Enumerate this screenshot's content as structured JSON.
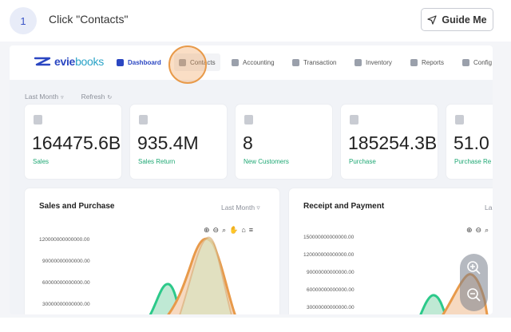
{
  "step": {
    "number": "1",
    "instruction": "Click \"Contacts\""
  },
  "guide_button": {
    "label": "Guide Me"
  },
  "app": {
    "logo": {
      "word_a": "evie",
      "word_b": "books"
    },
    "nav": [
      {
        "label": "Dashboard"
      },
      {
        "label": "Contacts"
      },
      {
        "label": "Accounting"
      },
      {
        "label": "Transaction"
      },
      {
        "label": "Inventory"
      },
      {
        "label": "Reports"
      },
      {
        "label": "Config"
      }
    ],
    "filters": {
      "period": "Last Month",
      "refresh": "Refresh"
    },
    "cards": [
      {
        "value": "164475.6B",
        "label": "Sales"
      },
      {
        "value": "935.4M",
        "label": "Sales Return"
      },
      {
        "value": "8",
        "label": "New Customers"
      },
      {
        "value": "185254.3B",
        "label": "Purchase"
      },
      {
        "value": "51.0",
        "label": "Purchase Re"
      }
    ],
    "panels": {
      "sales_purchase": {
        "title": "Sales and Purchase",
        "filter": "Last Month",
        "y_ticks": [
          "120000000000000.00",
          "90000000000000.00",
          "60000000000000.00",
          "30000000000000.00"
        ]
      },
      "receipt_payment": {
        "title": "Receipt and Payment",
        "filter": "La",
        "y_ticks": [
          "150000000000000.00",
          "120000000000000.00",
          "90000000000000.00",
          "60000000000000.00",
          "30000000000000.00"
        ]
      }
    }
  },
  "colors": {
    "accent": "#2b47c2",
    "green": "#1fa874",
    "orange": "#e89a4a"
  }
}
